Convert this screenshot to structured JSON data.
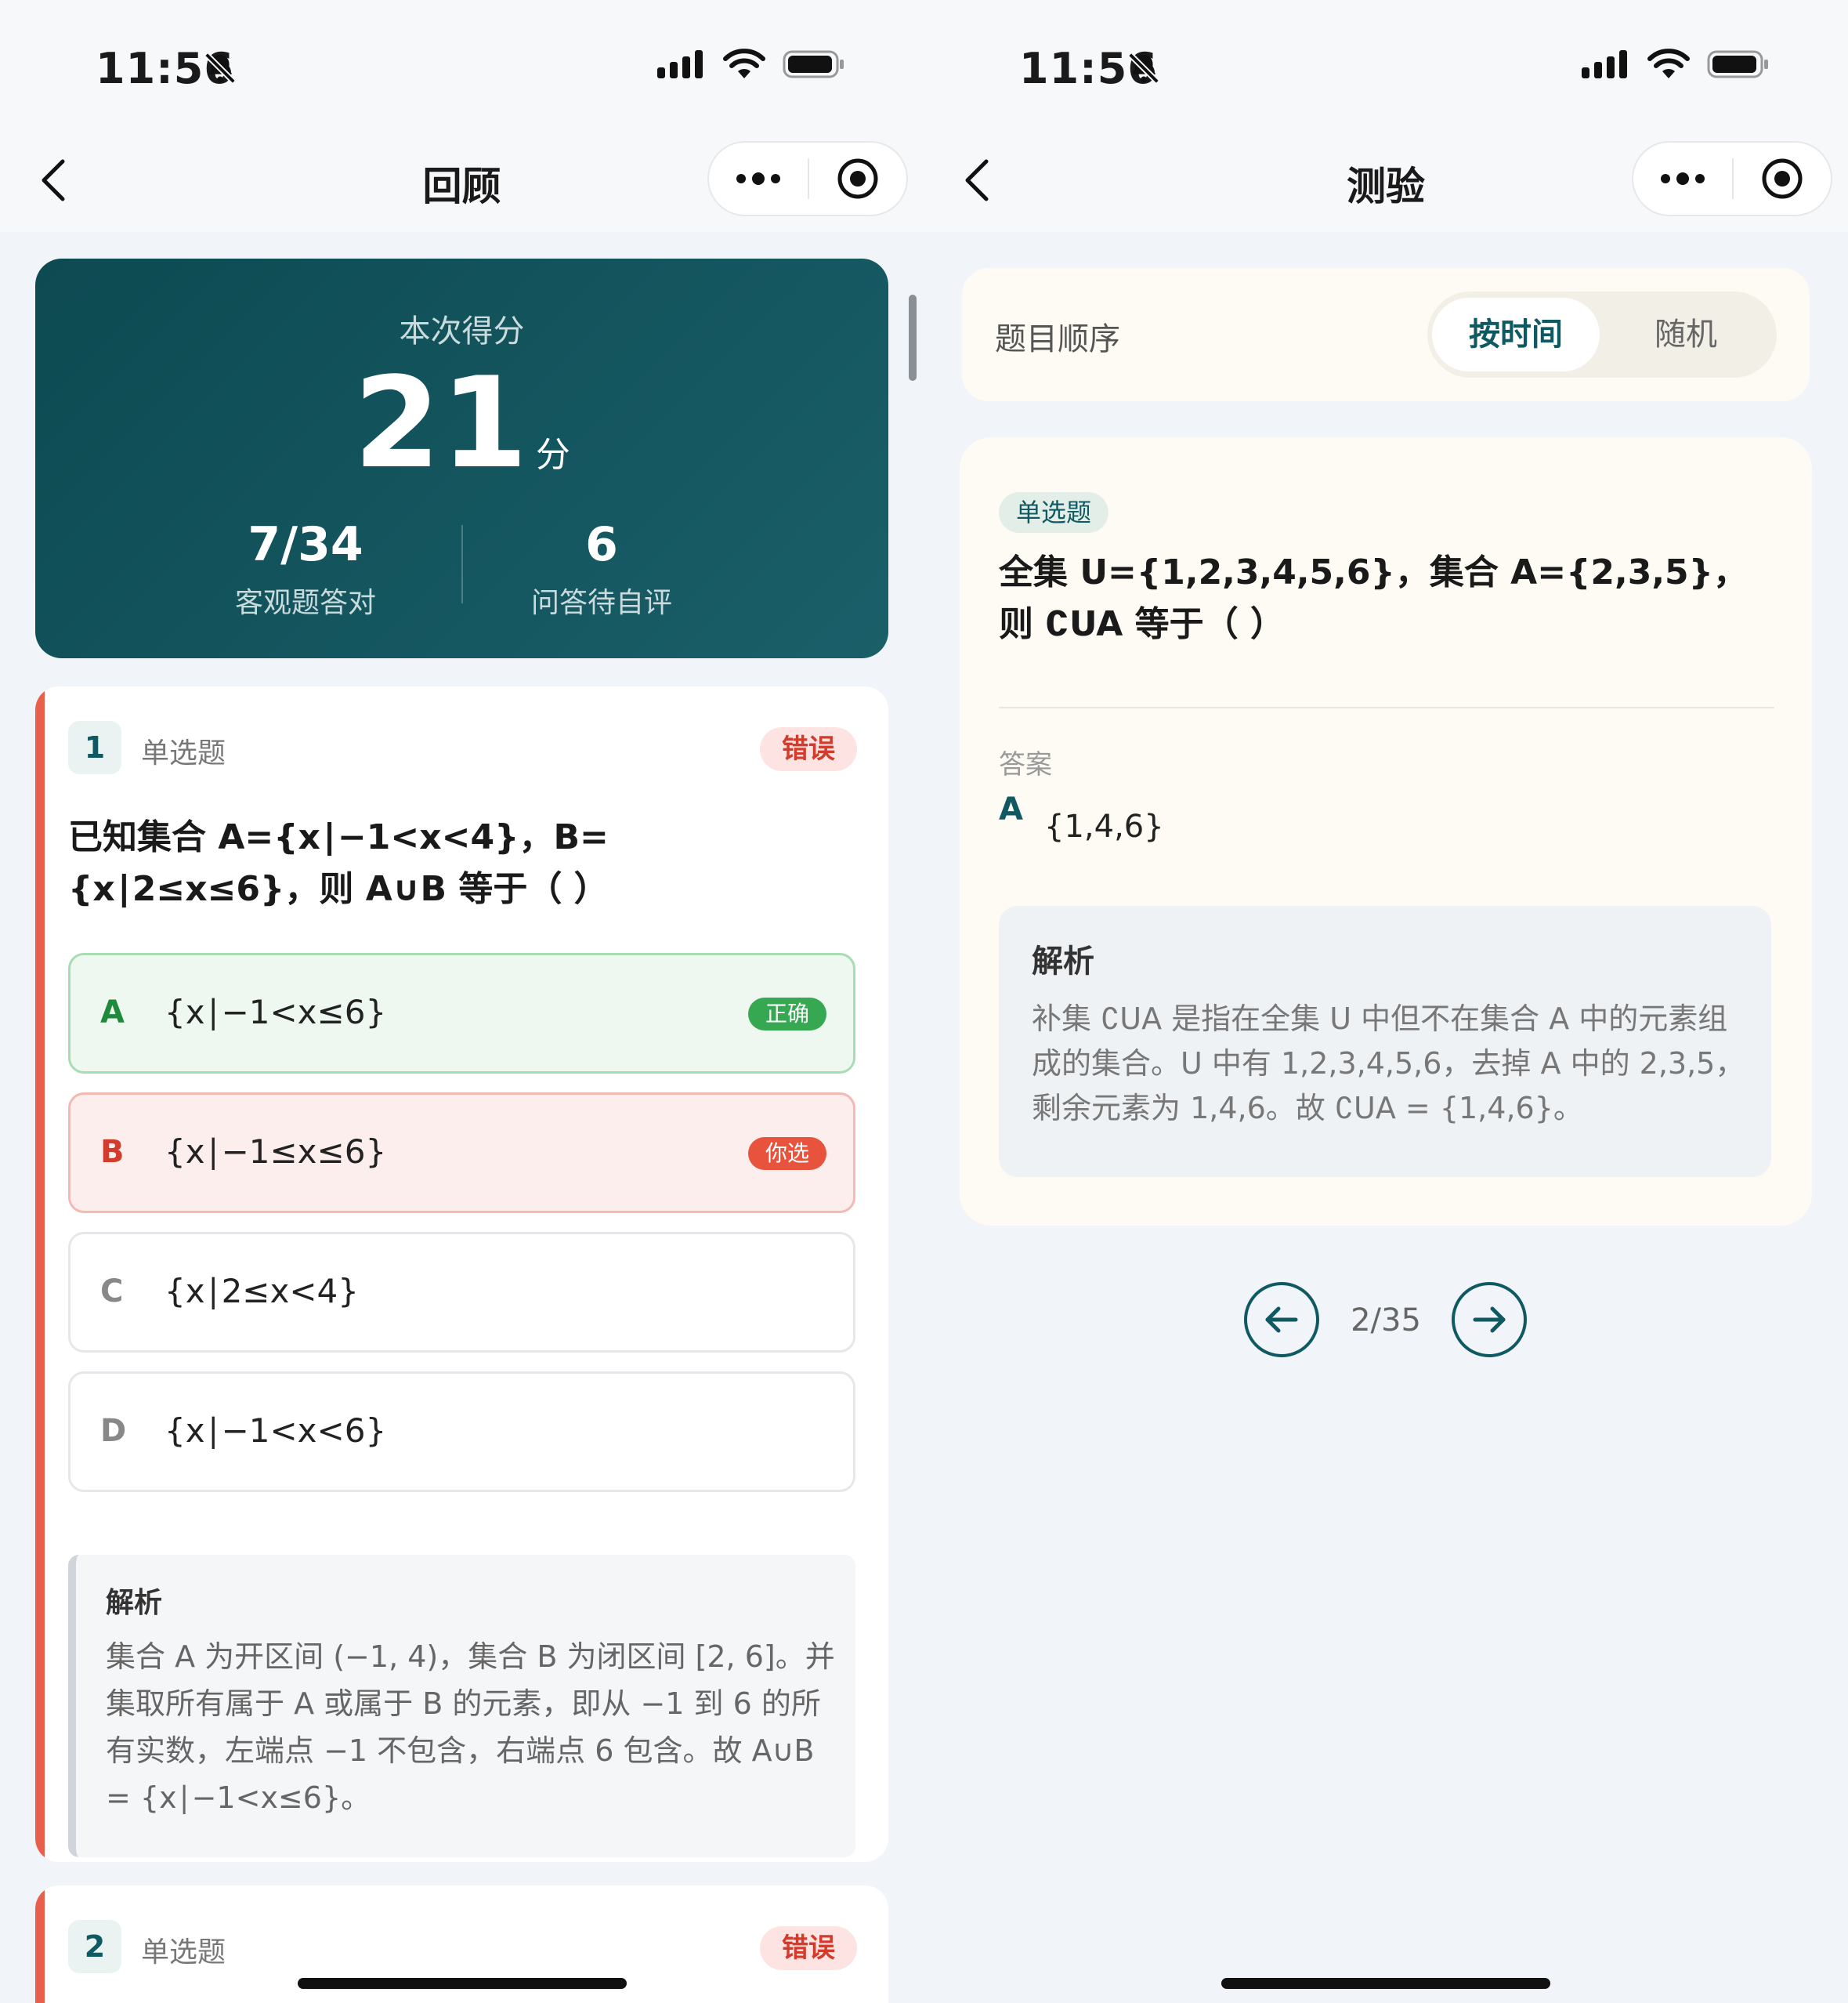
{
  "left": {
    "status": {
      "time": "11:56"
    },
    "nav": {
      "title": "回顾"
    },
    "score": {
      "label": "本次得分",
      "value": "21",
      "unit": "分",
      "stats": [
        {
          "value": "7/34",
          "label": "客观题答对"
        },
        {
          "value": "6",
          "label": "问答待自评"
        }
      ]
    },
    "question1": {
      "number": "1",
      "type": "单选题",
      "result": "错误",
      "text": "已知集合 A={x∣−1<x<4}，B={x∣2≤x≤6}，则 A∪B 等于（ ）",
      "options": [
        {
          "letter": "A",
          "text": "{x∣−1<x≤6}",
          "tag": "正确"
        },
        {
          "letter": "B",
          "text": "{x∣−1≤x≤6}",
          "tag": "你选"
        },
        {
          "letter": "C",
          "text": "{x∣2≤x<4}"
        },
        {
          "letter": "D",
          "text": "{x∣−1<x<6}"
        }
      ],
      "explanation_title": "解析",
      "explanation": "集合 A 为开区间 (−1, 4)，集合 B 为闭区间 [2, 6]。并集取所有属于 A 或属于 B 的元素，即从 −1 到 6 的所有实数，左端点 −1 不包含，右端点 6 包含。故 A∪B = {x∣−1<x≤6}。"
    },
    "question2": {
      "number": "2",
      "type": "单选题",
      "result": "错误"
    }
  },
  "right": {
    "status": {
      "time": "11:56"
    },
    "nav": {
      "title": "测验"
    },
    "order": {
      "label": "题目顺序",
      "options": [
        "按时间",
        "随机"
      ],
      "selected": "按时间"
    },
    "question": {
      "type": "单选题",
      "text": "全集 U={1,2,3,4,5,6}，集合 A={2,3,5}，则 ∁UA 等于（ ）",
      "answer_label": "答案",
      "answer_letter": "A",
      "answer_text": "{1,4,6}",
      "explanation_title": "解析",
      "explanation": "补集 ∁UA 是指在全集 U 中但不在集合 A 中的元素组成的集合。U 中有 1,2,3,4,5,6，去掉 A 中的 2,3,5，剩余元素为 1,4,6。故 ∁UA = {1,4,6}。"
    },
    "pager": {
      "text": "2/35"
    }
  },
  "icons": [
    "back-chevron-icon",
    "more-dots-icon",
    "target-circle-icon",
    "bell-slash-icon",
    "signal-icon",
    "wifi-icon",
    "battery-icon",
    "arrow-left-icon",
    "arrow-right-icon"
  ],
  "colors": {
    "teal": "#0f5a62",
    "wrong_red": "#d23c2c",
    "correct_green": "#36a852",
    "selected_red": "#e8533e"
  }
}
